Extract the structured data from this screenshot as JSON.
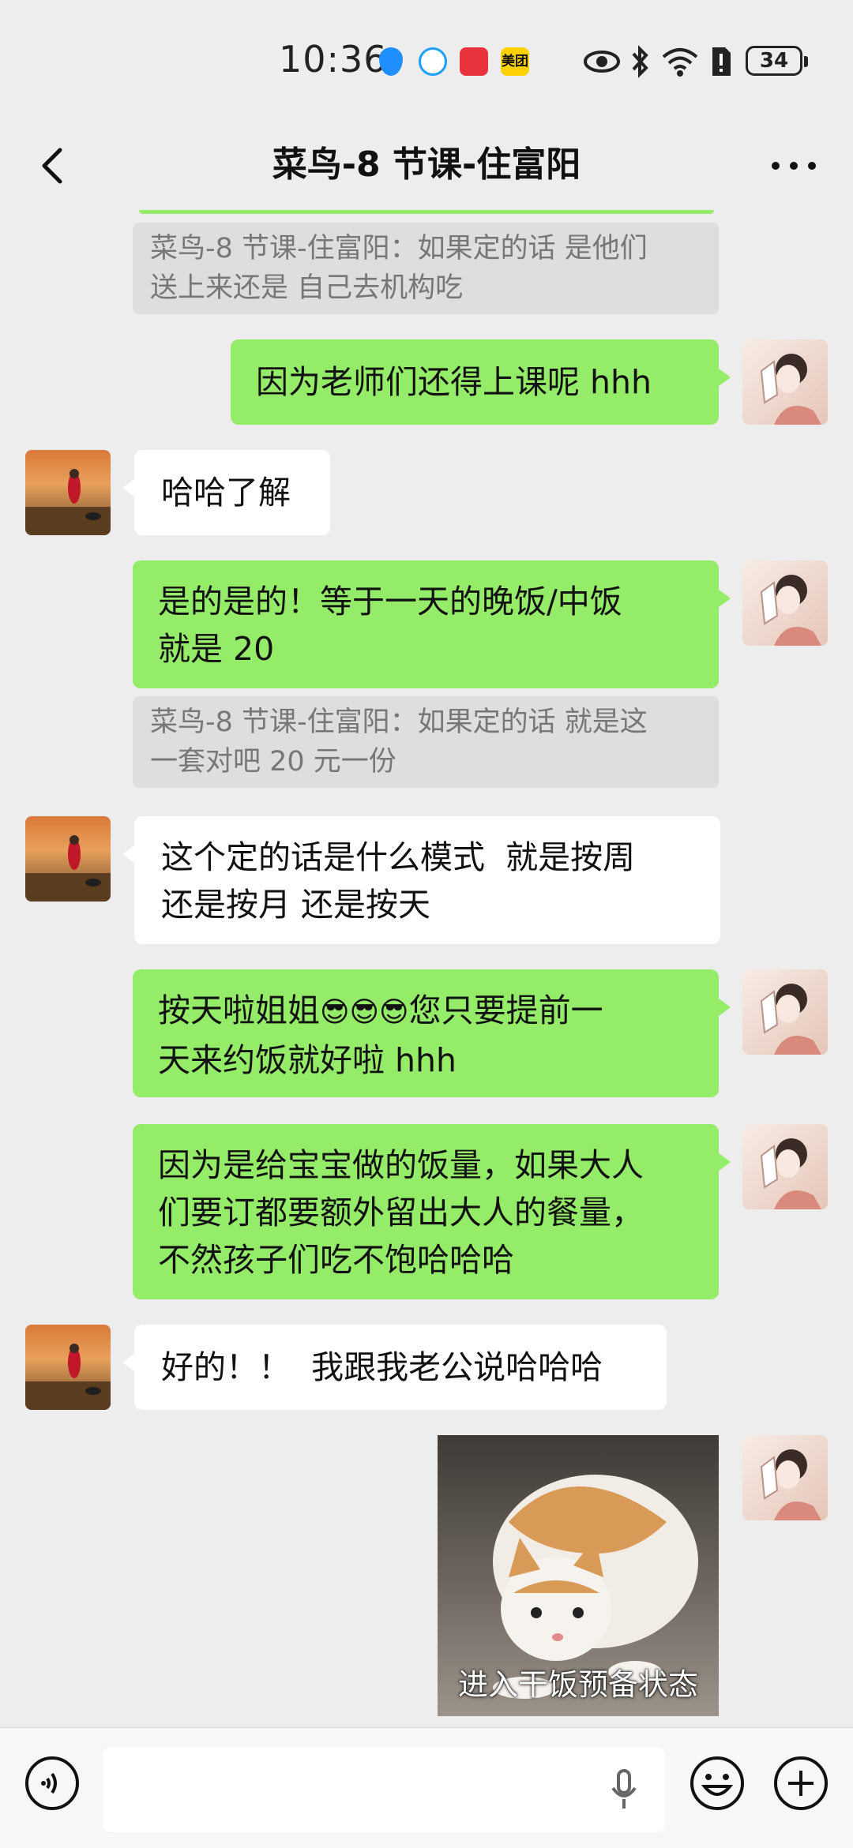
{
  "status_bar": {
    "time": "10:36",
    "battery": "34",
    "app_badge": "美团"
  },
  "header": {
    "title": "菜鸟-8 节课-住富阳"
  },
  "messages": {
    "q1": "菜鸟-8 节课-住富阳：如果定的话 是他们\n送上来还是 自己去机构吃",
    "m1": "因为老师们还得上课呢 hhh",
    "m2": "哈哈了解",
    "m3": "是的是的！等于一天的晚饭/中饭\n就是 20",
    "q2": "菜鸟-8 节课-住富阳：如果定的话 就是这\n一套对吧 20 元一份",
    "m4": "这个定的话是什么模式  就是按周\n还是按月 还是按天",
    "m5a": "按天啦姐姐",
    "m5b": "您只要提前一\n天来约饭就好啦 hhh",
    "m5_emoji": "😎😎😎",
    "m6": "因为是给宝宝做的饭量，如果大人\n们要订都要额外留出大人的餐量，\n不然孩子们吃不饱哈哈哈",
    "m7": "好的！！  我跟我老公说哈哈哈",
    "sticker_caption": "进入干饭预备状态"
  },
  "colors": {
    "me_bubble": "#95ec69",
    "them_bubble": "#ffffff",
    "background": "#ededed"
  },
  "icons": {
    "back": "chevron-left-icon",
    "more": "more-dots-icon",
    "voice": "voice-icon",
    "mic": "microphone-icon",
    "emoji": "emoji-icon",
    "add": "plus-icon"
  }
}
